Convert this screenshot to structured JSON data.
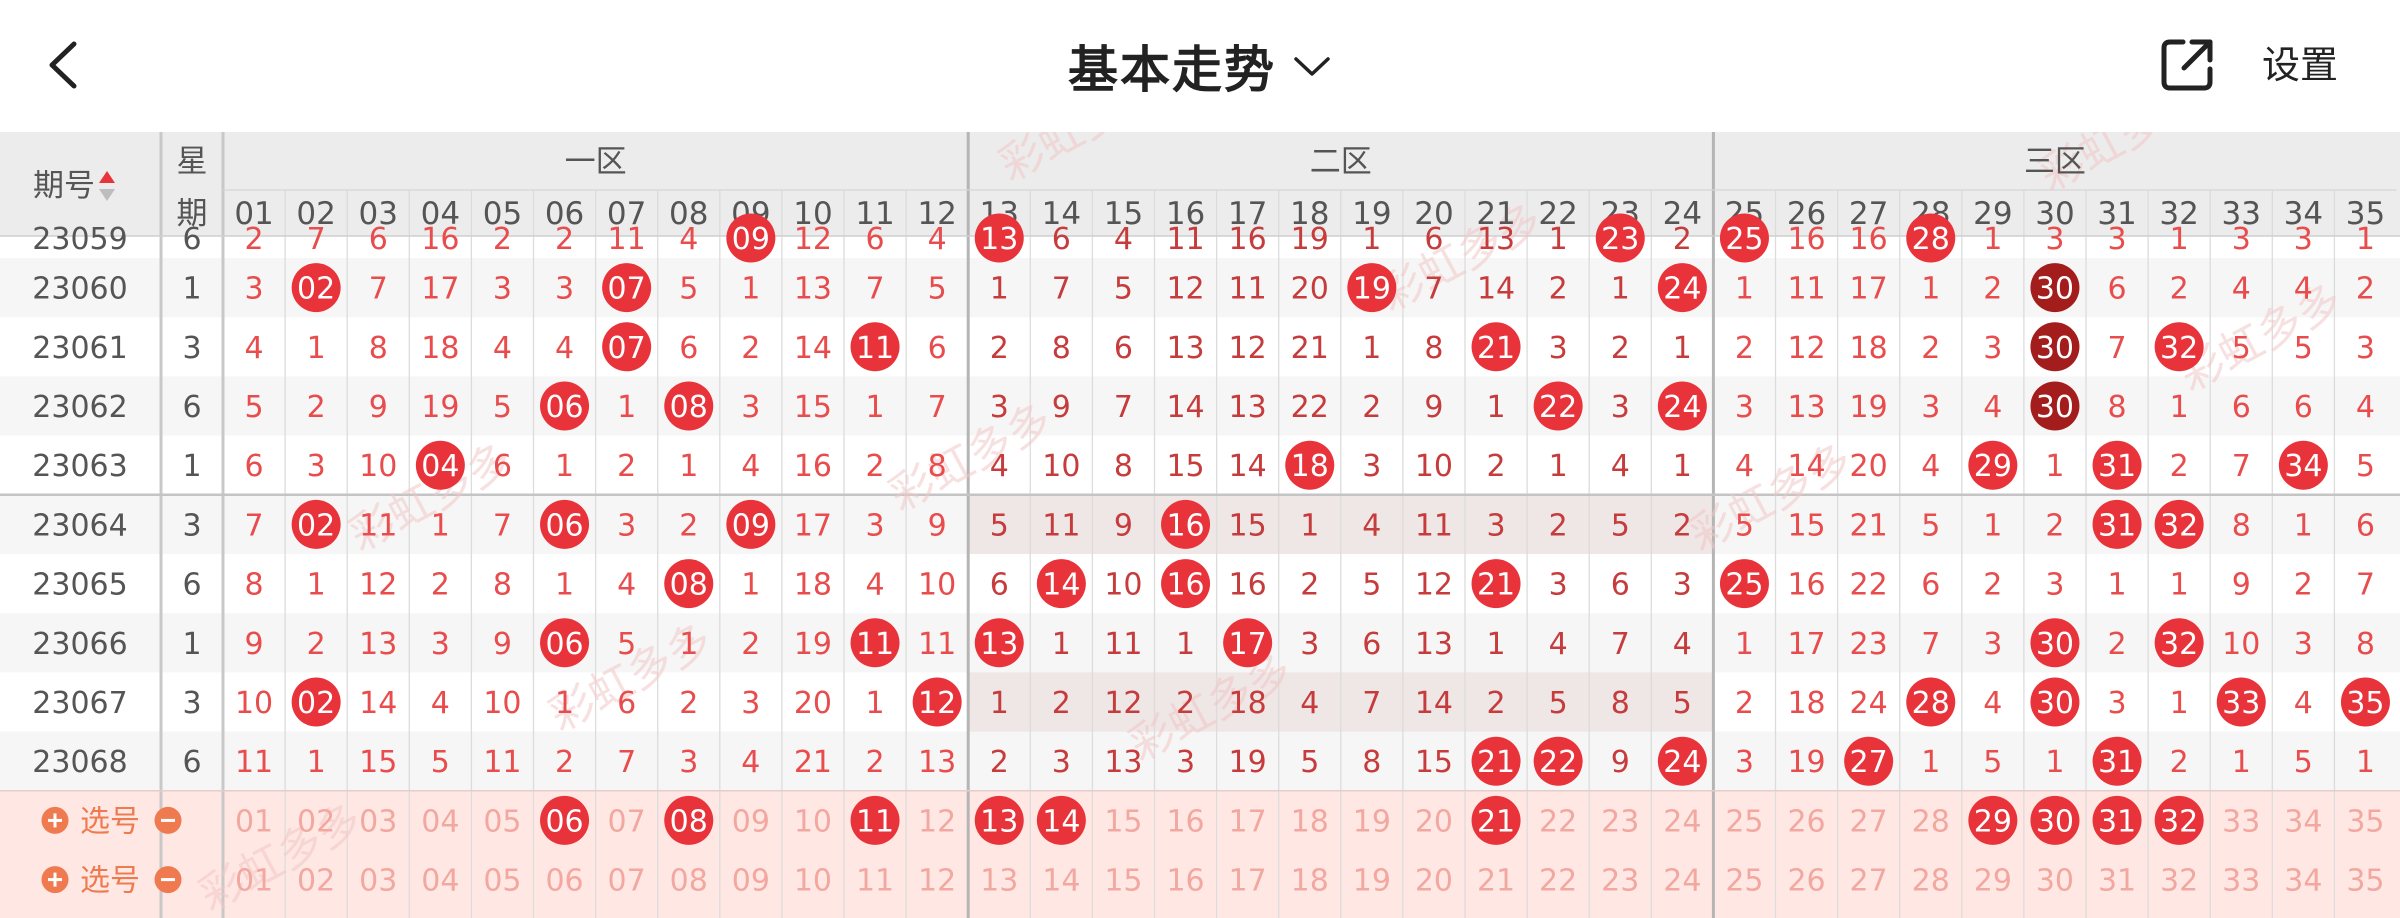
{
  "header": {
    "title": "基本走势",
    "settings_label": "设置",
    "back_icon": "chevron-left-icon",
    "dropdown_icon": "chevron-down-icon",
    "share_icon": "share-icon"
  },
  "table": {
    "issue_header": "期号",
    "weekday_header_top": "星",
    "weekday_header_bottom": "期",
    "zones": [
      {
        "label": "一区",
        "from": 1,
        "to": 12
      },
      {
        "label": "二区",
        "from": 13,
        "to": 24
      },
      {
        "label": "三区",
        "from": 25,
        "to": 35
      }
    ],
    "columns": [
      "01",
      "02",
      "03",
      "04",
      "05",
      "06",
      "07",
      "08",
      "09",
      "10",
      "11",
      "12",
      "13",
      "14",
      "15",
      "16",
      "17",
      "18",
      "19",
      "20",
      "21",
      "22",
      "23",
      "24",
      "25",
      "26",
      "27",
      "28",
      "29",
      "30",
      "31",
      "32",
      "33",
      "34",
      "35"
    ],
    "partial_row": {
      "issue": "23059",
      "weekday": "6",
      "cells": [
        "2",
        "7",
        "6",
        "16",
        "2",
        "2",
        "11",
        "4",
        "09",
        "12",
        "6",
        "4",
        "13",
        "6",
        "4",
        "11",
        "16",
        "19",
        "1",
        "6",
        "13",
        "1",
        "23",
        "2",
        "25",
        "16",
        "16",
        "28",
        "1",
        "3",
        "3",
        "1",
        "3",
        "3",
        "1"
      ]
    },
    "rows": [
      {
        "issue": "23060",
        "weekday": "1",
        "cells": [
          "3",
          "02",
          "7",
          "17",
          "3",
          "3",
          "07",
          "5",
          "1",
          "13",
          "7",
          "5",
          "1",
          "7",
          "5",
          "12",
          "11",
          "20",
          "19",
          "7",
          "14",
          "2",
          "1",
          "24",
          "1",
          "11",
          "17",
          "1",
          "2",
          "30",
          "6",
          "2",
          "4",
          "4",
          "2"
        ]
      },
      {
        "issue": "23061",
        "weekday": "3",
        "cells": [
          "4",
          "1",
          "8",
          "18",
          "4",
          "4",
          "07",
          "6",
          "2",
          "14",
          "11",
          "6",
          "2",
          "8",
          "6",
          "13",
          "12",
          "21",
          "1",
          "8",
          "21",
          "3",
          "2",
          "1",
          "2",
          "12",
          "18",
          "2",
          "3",
          "30",
          "7",
          "32",
          "5",
          "5",
          "3"
        ]
      },
      {
        "issue": "23062",
        "weekday": "6",
        "cells": [
          "5",
          "2",
          "9",
          "19",
          "5",
          "06",
          "1",
          "08",
          "3",
          "15",
          "1",
          "7",
          "3",
          "9",
          "7",
          "14",
          "13",
          "22",
          "2",
          "9",
          "1",
          "22",
          "3",
          "24",
          "3",
          "13",
          "19",
          "3",
          "4",
          "30",
          "8",
          "1",
          "6",
          "6",
          "4"
        ]
      },
      {
        "issue": "23063",
        "weekday": "1",
        "cells": [
          "6",
          "3",
          "10",
          "04",
          "6",
          "1",
          "2",
          "1",
          "4",
          "16",
          "2",
          "8",
          "4",
          "10",
          "8",
          "15",
          "14",
          "18",
          "3",
          "10",
          "2",
          "1",
          "4",
          "1",
          "4",
          "14",
          "20",
          "4",
          "29",
          "1",
          "31",
          "2",
          "7",
          "34",
          "5"
        ]
      },
      {
        "issue": "23064",
        "weekday": "3",
        "cells": [
          "7",
          "02",
          "11",
          "1",
          "7",
          "06",
          "3",
          "2",
          "09",
          "17",
          "3",
          "9",
          "5",
          "11",
          "9",
          "16",
          "15",
          "1",
          "4",
          "11",
          "3",
          "2",
          "5",
          "2",
          "5",
          "15",
          "21",
          "5",
          "1",
          "2",
          "31",
          "32",
          "8",
          "1",
          "6"
        ]
      },
      {
        "issue": "23065",
        "weekday": "6",
        "cells": [
          "8",
          "1",
          "12",
          "2",
          "8",
          "1",
          "4",
          "08",
          "1",
          "18",
          "4",
          "10",
          "6",
          "14",
          "10",
          "16",
          "16",
          "2",
          "5",
          "12",
          "21",
          "3",
          "6",
          "3",
          "25",
          "16",
          "22",
          "6",
          "2",
          "3",
          "1",
          "1",
          "9",
          "2",
          "7"
        ]
      },
      {
        "issue": "23066",
        "weekday": "1",
        "cells": [
          "9",
          "2",
          "13",
          "3",
          "9",
          "06",
          "5",
          "1",
          "2",
          "19",
          "11",
          "11",
          "13",
          "1",
          "11",
          "1",
          "17",
          "3",
          "6",
          "13",
          "1",
          "4",
          "7",
          "4",
          "1",
          "17",
          "23",
          "7",
          "3",
          "30",
          "2",
          "32",
          "10",
          "3",
          "8"
        ]
      },
      {
        "issue": "23067",
        "weekday": "3",
        "cells": [
          "10",
          "02",
          "14",
          "4",
          "10",
          "1",
          "6",
          "2",
          "3",
          "20",
          "1",
          "12",
          "1",
          "2",
          "12",
          "2",
          "18",
          "4",
          "7",
          "14",
          "2",
          "5",
          "8",
          "5",
          "2",
          "18",
          "24",
          "28",
          "4",
          "30",
          "3",
          "1",
          "33",
          "4",
          "35"
        ]
      },
      {
        "issue": "23068",
        "weekday": "6",
        "cells": [
          "11",
          "1",
          "15",
          "5",
          "11",
          "2",
          "7",
          "3",
          "4",
          "21",
          "2",
          "13",
          "2",
          "3",
          "13",
          "3",
          "19",
          "5",
          "8",
          "15",
          "21",
          "22",
          "9",
          "24",
          "3",
          "19",
          "27",
          "1",
          "5",
          "1",
          "31",
          "2",
          "1",
          "5",
          "1"
        ]
      }
    ],
    "select_rows": [
      {
        "label": "选号",
        "picked": [
          "06",
          "08",
          "11",
          "13",
          "14",
          "21",
          "29",
          "30",
          "31",
          "32"
        ]
      },
      {
        "label": "选号",
        "picked": []
      }
    ]
  },
  "watermark": "彩虹多多",
  "colors": {
    "ball_red": "#e8333a",
    "ball_dark": "#a31d1d",
    "text_red": "#e84c4c",
    "header_bg": "#ececec",
    "select_bg": "#ffe8e3",
    "zone_divider": "#b5b5b5"
  }
}
